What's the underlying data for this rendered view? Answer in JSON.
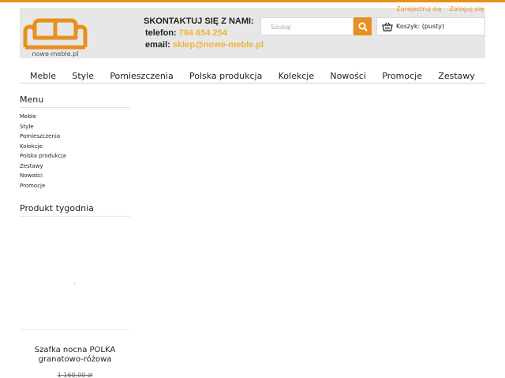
{
  "header": {
    "logo": {
      "icon": "sofa-logo",
      "text": "nowe-meble.pl",
      "accent_color": "#e8901f"
    },
    "contact": {
      "title": "SKONTAKTUJ SIĘ Z NAMI:",
      "phone_label": "telefon:",
      "phone": "784 654 254",
      "email_label": "email:",
      "email": "sklep@nowe-meble.pl"
    },
    "search": {
      "placeholder": "Szukaj",
      "icon": "search-icon"
    },
    "cart": {
      "icon": "basket-icon",
      "label": "Koszyk: (pusty)"
    },
    "user_links": {
      "register": "Zarejestruj się",
      "login": "Zaloguj się"
    }
  },
  "nav": {
    "items": [
      "Meble",
      "Style",
      "Pomieszczenia",
      "Polska produkcja",
      "Kolekcje",
      "Nowości",
      "Promocje",
      "Zestawy"
    ]
  },
  "sidebar": {
    "menu_title": "Menu",
    "menu_items": [
      "Meble",
      "Style",
      "Pomieszczenia",
      "Kolekcje",
      "Polska produkcja",
      "Zestawy",
      "Nowości",
      "Promocje"
    ],
    "product_week_title": "Produkt tygodnia",
    "product": {
      "name_line1": "Szafka nocna POLKA",
      "name_line2": "granatowo-różowa",
      "old_price": "1 160,00 zł"
    }
  },
  "colors": {
    "accent": "#e8901f",
    "contact_value": "#f0b33a",
    "header_bg": "#e7e7e7"
  }
}
